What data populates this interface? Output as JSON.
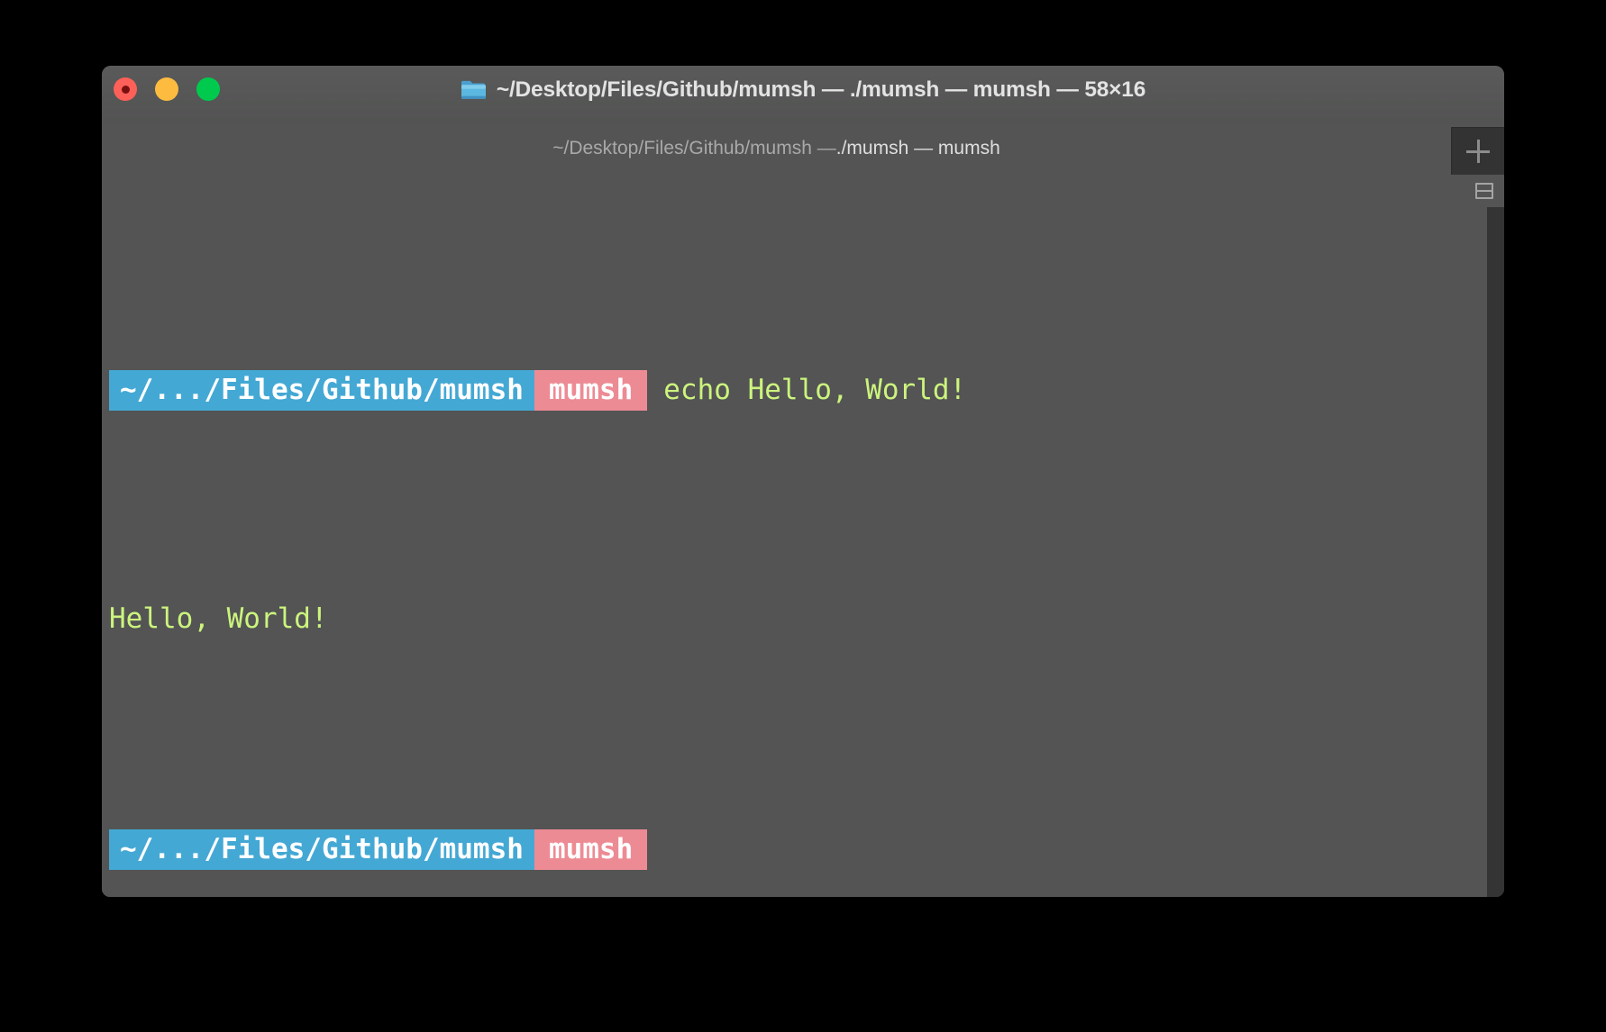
{
  "window": {
    "title": "~/Desktop/Files/Github/mumsh — ./mumsh — mumsh — 58×16",
    "folder_icon": "folder-icon",
    "controls": {
      "close_label": "close-button",
      "minimize_label": "minimize-button",
      "maximize_label": "maximize-button"
    }
  },
  "tabbar": {
    "active_tab": {
      "title_dim": "~/Desktop/Files/Github/mumsh — ",
      "title_bright": "./mumsh — mumsh"
    },
    "new_tab_icon": "plus-icon"
  },
  "body_controls": {
    "split_pane_icon": "split-pane-icon",
    "scrollbar": "vertical-scrollbar"
  },
  "terminal": {
    "columns": 58,
    "rows": 16,
    "lines": [
      {
        "type": "prompt",
        "path": "~/.../Files/Github/mumsh",
        "branch": "mumsh",
        "command": "echo Hello, World!"
      },
      {
        "type": "output",
        "text": "Hello, World!"
      },
      {
        "type": "prompt",
        "path": "~/.../Files/Github/mumsh",
        "branch": "mumsh",
        "command": ""
      }
    ]
  },
  "colors": {
    "window_chrome": "#535453",
    "terminal_bg": "#535453",
    "path_segment": "#44a8d4",
    "branch_segment": "#ed8b94",
    "text_green": "#ccf47e",
    "title_text": "#e3e3e3",
    "tab_dim_text": "#a8a9a8",
    "close_button": "#fc6058",
    "minimize_button": "#fdbc40",
    "maximize_button": "#00ca4e",
    "page_background": "#000000"
  }
}
